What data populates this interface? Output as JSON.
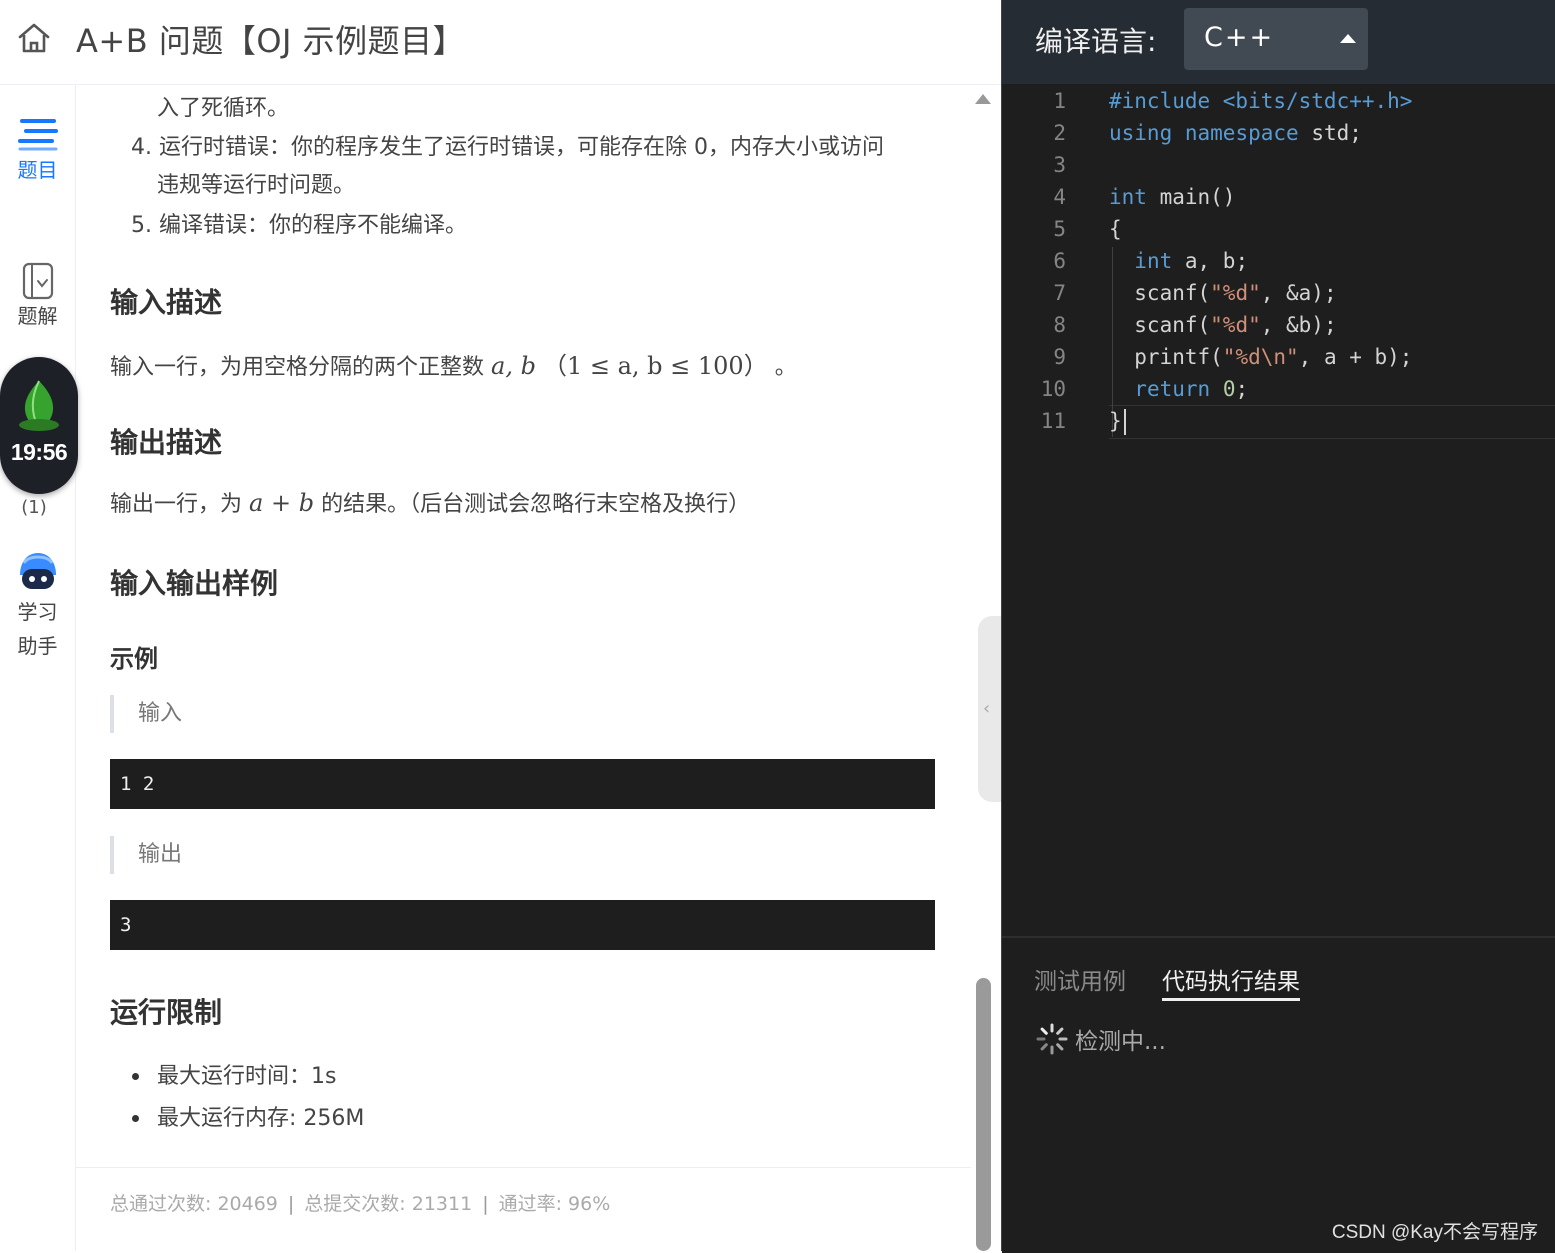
{
  "header": {
    "title": "A+B 问题【OJ 示例题目】"
  },
  "sidebar": {
    "items": [
      {
        "label": "题目",
        "icon": "problem-list-icon",
        "active": true
      },
      {
        "label": "题解",
        "icon": "solution-icon"
      },
      {
        "label": "学习助手",
        "icon": "assistant-robot-icon"
      }
    ],
    "timer": "19:56",
    "timer_count": "(1)"
  },
  "problem": {
    "partial_line": "入了死循环。",
    "result_items": [
      {
        "num": "4.",
        "line1": "运行时错误：你的程序发生了运行时错误，可能存在除 0，内存大小或访问",
        "line2": "违规等运行时问题。"
      },
      {
        "num": "5.",
        "line1": "编译错误：你的程序不能编译。"
      }
    ],
    "input_heading": "输入描述",
    "input_desc_pre": "输入一行，为用空格分隔的两个正整数",
    "input_desc_vars": "a, b",
    "input_desc_range": "（1 ≤ a, b ≤ 100）",
    "input_desc_post": "。",
    "output_heading": "输出描述",
    "output_desc_pre": "输出一行，为",
    "output_desc_math": "a + b",
    "output_desc_post": "的结果。（后台测试会忽略行末空格及换行）",
    "samples_heading": "输入输出样例",
    "example_label": "示例",
    "input_label": "输入",
    "sample_input": "1 2",
    "output_label": "输出",
    "sample_output": "3",
    "limits_heading": "运行限制",
    "limits": [
      "最大运行时间：1s",
      "最大运行内存: 256M"
    ],
    "stats": {
      "passed": "总通过次数: 20469",
      "submitted": "总提交次数: 21311",
      "rate": "通过率: 96%"
    }
  },
  "editor": {
    "language_label": "编译语言:",
    "language_value": "C++",
    "line_numbers": [
      "1",
      "2",
      "3",
      "4",
      "5",
      "6",
      "7",
      "8",
      "9",
      "10",
      "11"
    ],
    "code": [
      "#include <bits/stdc++.h>",
      "using namespace std;",
      "",
      "int main()",
      "{",
      "  int a, b;",
      "  scanf(\"%d\", &a);",
      "  scanf(\"%d\", &b);",
      "  printf(\"%d\\n\", a + b);",
      "  return 0;",
      "}"
    ]
  },
  "result_panel": {
    "tabs": [
      "测试用例",
      "代码执行结果"
    ],
    "active_tab": "代码执行结果",
    "status": "检测中..."
  },
  "watermark": "CSDN @Kay不会写程序",
  "colors": {
    "editor_bg": "#1e1e1e",
    "keyword": "#569cd6",
    "string": "#ce9178",
    "accent_blue": "#1677ff"
  }
}
